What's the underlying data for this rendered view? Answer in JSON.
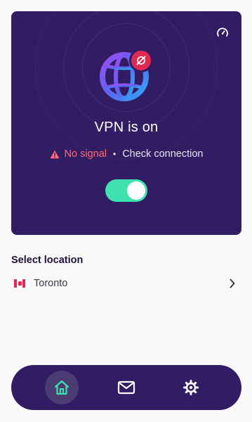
{
  "status_card": {
    "title": "VPN is on",
    "warning": "No signal",
    "separator": "•",
    "hint": "Check connection",
    "toggle_on": true,
    "icons": {
      "speed": "speedometer-icon",
      "globe": "globe-icon",
      "badge": "no-signal-icon",
      "warning": "warning-icon"
    }
  },
  "location": {
    "heading": "Select location",
    "selected": "Toronto",
    "flag": "canada-flag-icon",
    "chevron": "chevron-right-icon"
  },
  "nav": {
    "items": [
      {
        "id": "home",
        "icon": "home-icon",
        "active": true
      },
      {
        "id": "messages",
        "icon": "message-icon",
        "active": false
      },
      {
        "id": "settings",
        "icon": "gear-icon",
        "active": false
      }
    ]
  },
  "colors": {
    "background": "#f9f9fa",
    "card": "#321c64",
    "accent": "#3fe1b0",
    "warning": "#ff6a75",
    "badge": "#e22850"
  }
}
